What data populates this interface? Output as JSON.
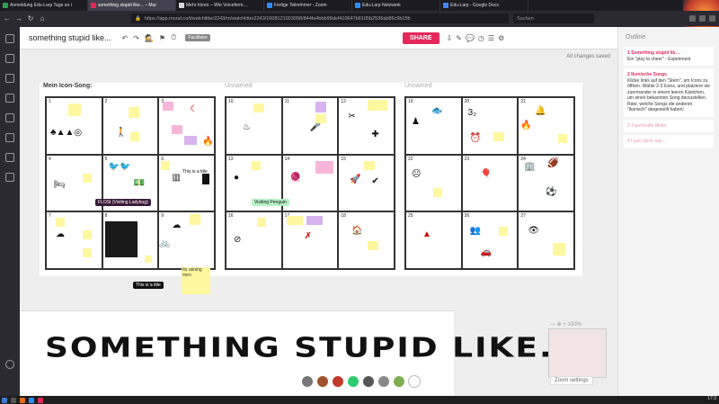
{
  "tabs": [
    {
      "label": "Anmeldung Edu-Larp Tage an i",
      "color": "#2e9e4f",
      "active": false
    },
    {
      "label": "something stupid like... – Mur",
      "color": "#e5285a",
      "active": true
    },
    {
      "label": "Mehr hören – Wie Voiceferm…",
      "color": "#d9d9d9",
      "active": false
    },
    {
      "label": "Fertige Teilnehmer - Zoom",
      "color": "#2d8cff",
      "active": false
    },
    {
      "label": "Edu-Larp Netzwerk",
      "color": "#2d8cff",
      "active": false
    },
    {
      "label": "Edu-Larp - Google Docs",
      "color": "#4285f4",
      "active": false
    }
  ],
  "browser": {
    "url": "https://app.mural.co/t/walchlitter2243/m/walchlitter2243/1608121903998/844fa4bbb99def410647b6105b2536ab86c9b15b",
    "search_placeholder": "Suchen"
  },
  "mural": {
    "title": "something stupid like...",
    "facilitator": "Facilitator",
    "share_label": "SHARE",
    "saved_status": "All changes saved"
  },
  "boards": [
    {
      "title": "Mein Icon-Song:",
      "cells": [
        "1",
        "2",
        "3",
        "4",
        "5",
        "6",
        "7",
        "8",
        "9"
      ]
    },
    {
      "title": "Unnamed",
      "cells": [
        "10",
        "11",
        "12",
        "13",
        "14",
        "15",
        "16",
        "17",
        "18"
      ]
    },
    {
      "title": "Unnamed",
      "cells": [
        "19",
        "20",
        "21",
        "22",
        "23",
        "24",
        "25",
        "26",
        "27"
      ]
    }
  ],
  "canvas_labels": {
    "title_note": "This is a title",
    "visiting_ladybug": "FLOSt (Visiting Ladybug)",
    "visiting_penguin": "Visiting Penguin",
    "raining_men": "Its raining men",
    "banner": "SOMETHING STUPID LIKE..."
  },
  "outline": {
    "heading": "Outline",
    "items": [
      {
        "title": "1 Something stupid lik…",
        "body": "Ein \"play to cheer\" - Experiment"
      },
      {
        "title": "2 Ikonische Songs",
        "body": "Klicke links auf den \"Stern\", um Icons zu öffnen. Wähle 2-3 Icons, und platziere sie zuerrnander in einem leeren Kästchen, um einen bekannten Song darzustellen. Rate, welche Songs die anderen \"ikonisch\" dargestellt haben!"
      },
      {
        "title": "3 Traumhafte Bilder",
        "body": ""
      },
      {
        "title": "4 I just call to say…",
        "body": ""
      }
    ]
  },
  "zoom": {
    "settings_label": "Zoom settings",
    "level": "150%"
  },
  "clock": "17:3"
}
